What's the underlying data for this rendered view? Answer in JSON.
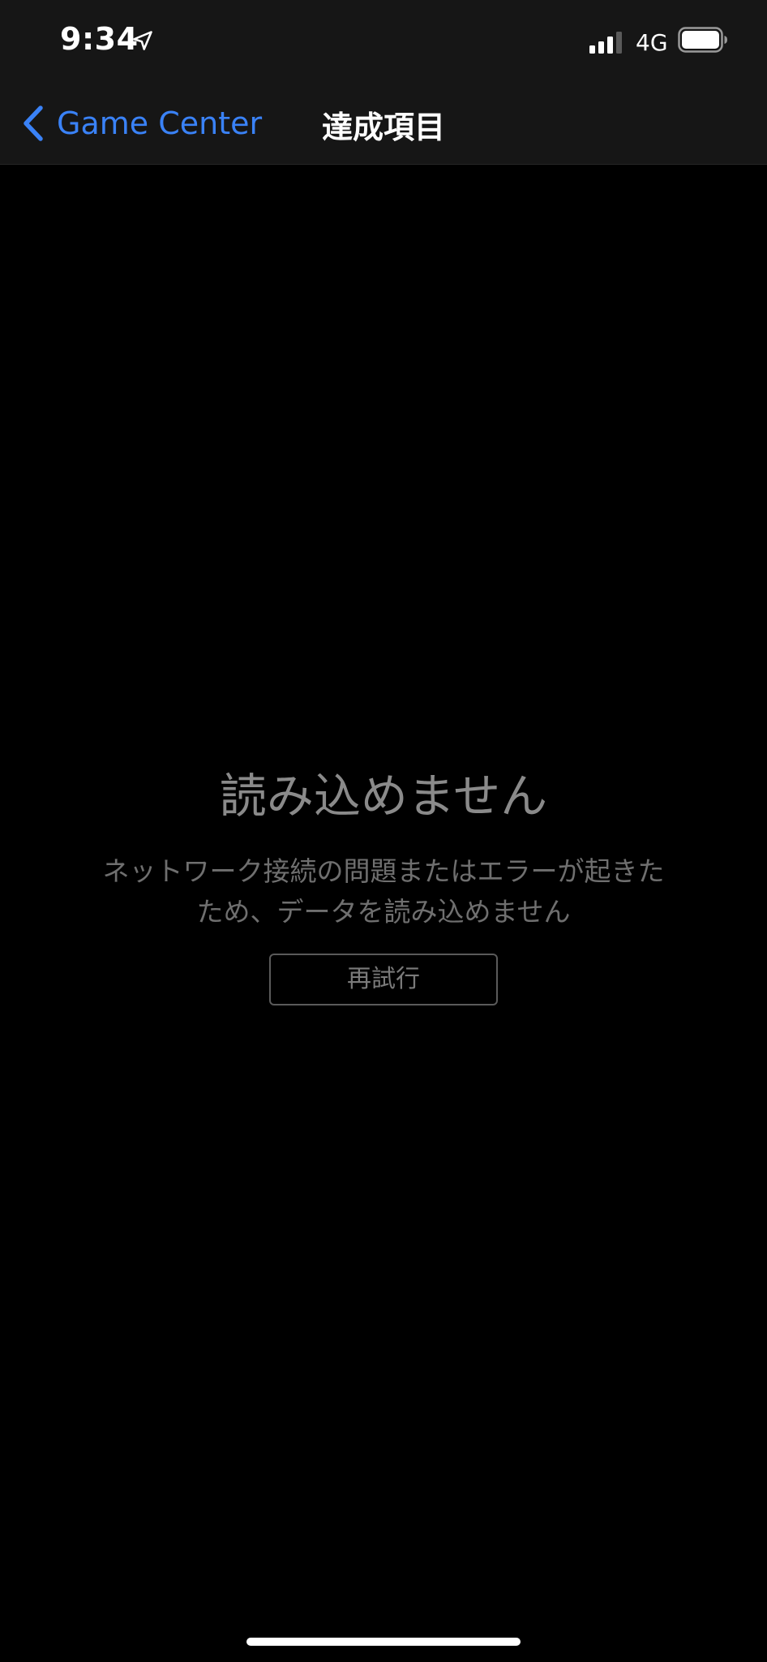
{
  "status_bar": {
    "time": "9:34",
    "network": "4G",
    "icons": [
      "location-arrow-icon",
      "cellular-signal-icon",
      "battery-icon"
    ]
  },
  "nav": {
    "back_label": "Game Center",
    "back_icon": "chevron-left-icon",
    "title": "達成項目"
  },
  "error": {
    "title": "読み込めません",
    "message": "ネットワーク接続の問題またはエラーが起きたため、データを読み込めません",
    "retry_label": "再試行"
  },
  "colors": {
    "accent": "#3a82f7",
    "background": "#000000",
    "header": "#161616",
    "muted_text": "#8a8a8a"
  }
}
